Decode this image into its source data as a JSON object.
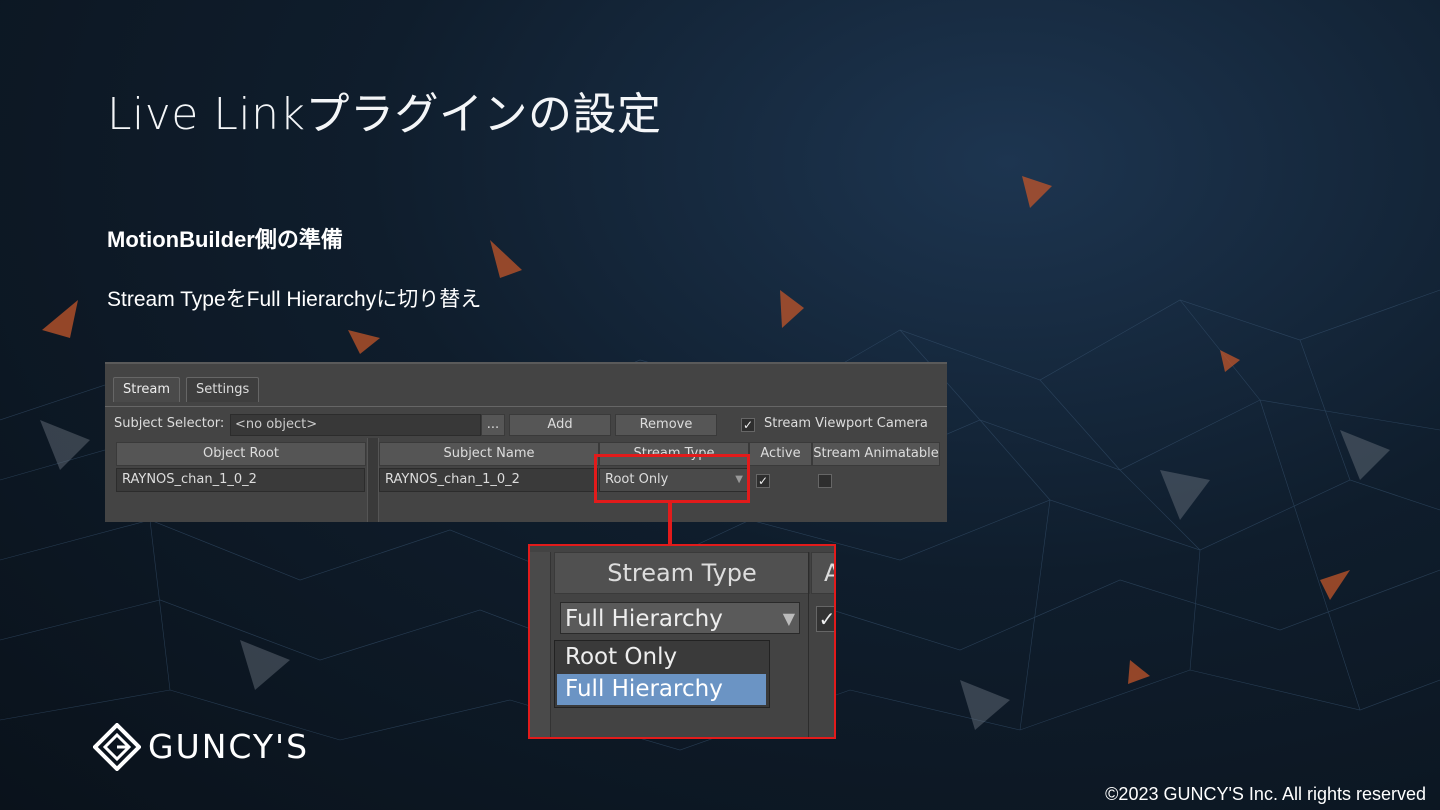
{
  "slide": {
    "title": "Live Linkプラグインの設定",
    "section_heading": "MotionBuilder側の準備",
    "instruction": "Stream TypeをFull Hierarchyに切り替え"
  },
  "mb_panel": {
    "tabs": [
      {
        "label": "Stream"
      },
      {
        "label": "Settings"
      }
    ],
    "subject_selector_label": "Subject Selector:",
    "subject_selector_value": "<no object>",
    "browse_button": "...",
    "add_button": "Add",
    "remove_button": "Remove",
    "stream_viewport_camera_label": "Stream Viewport Camera",
    "stream_viewport_camera_checked": true,
    "headers": {
      "object_root": "Object Root",
      "subject_name": "Subject Name",
      "stream_type": "Stream Type",
      "active": "Active",
      "stream_animatable": "Stream Animatable"
    },
    "row": {
      "object_root": "RAYNOS_chan_1_0_2",
      "subject_name": "RAYNOS_chan_1_0_2",
      "stream_type": "Root Only",
      "active_checked": true,
      "stream_animatable_checked": false
    }
  },
  "zoom": {
    "header": "Stream Type",
    "next_header_fragment": "A",
    "selected_value": "Full Hierarchy",
    "options": [
      {
        "label": "Root Only",
        "selected": false
      },
      {
        "label": "Full Hierarchy",
        "selected": true
      }
    ]
  },
  "footer": {
    "logo_text": "GUNCY'S",
    "copyright": "©2023 GUNCY'S Inc. All rights reserved"
  },
  "colors": {
    "highlight": "#e21b1b",
    "selection": "#6b94c4",
    "background": "#0f1d2c"
  }
}
